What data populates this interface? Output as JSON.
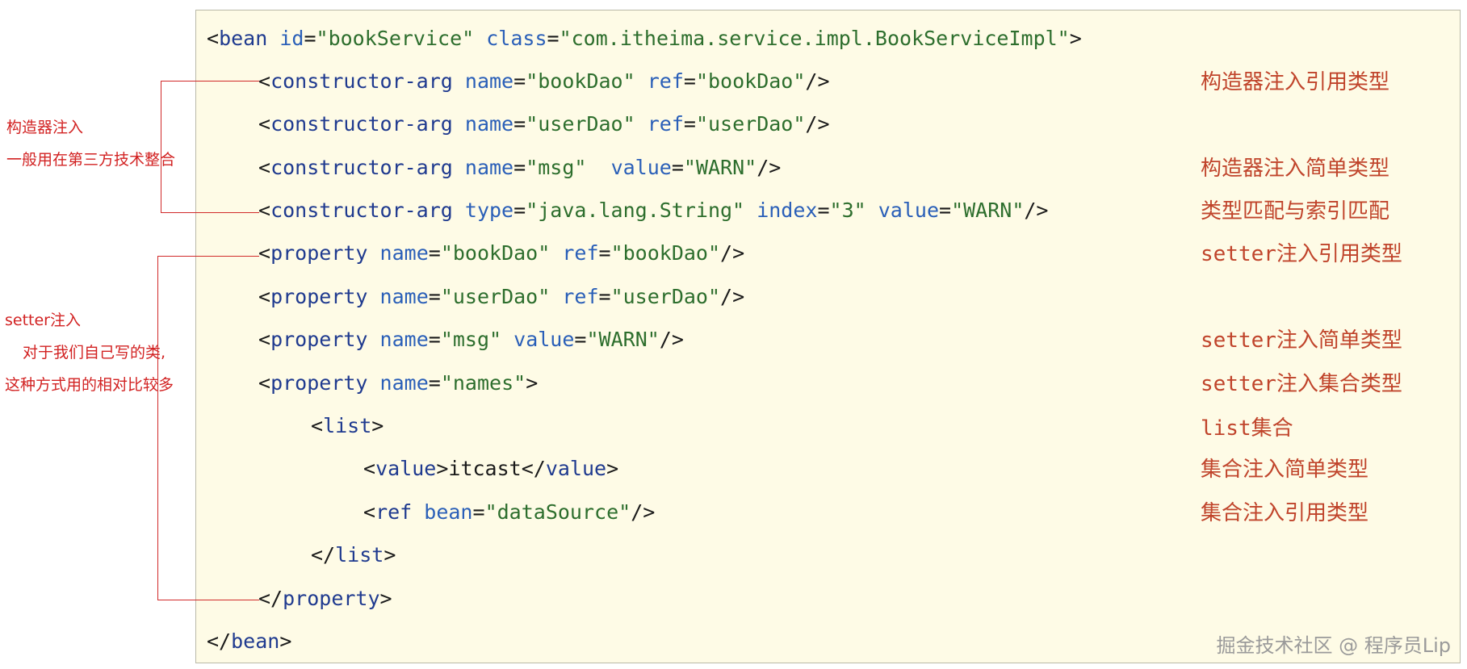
{
  "code": {
    "l1": {
      "o": "<",
      "tag": "bean",
      "a1": "id",
      "eq1": "=",
      "v1": "\"bookService\"",
      "a2": "class",
      "eq2": "=",
      "v2": "\"com.itheima.service.impl.BookServiceImpl\"",
      "c": ">"
    },
    "l2": {
      "o": "<",
      "tag": "constructor-arg",
      "a1": "name",
      "eq1": "=",
      "v1": "\"bookDao\"",
      "a2": "ref",
      "eq2": "=",
      "v2": "\"bookDao\"",
      "c": "/>"
    },
    "l3": {
      "o": "<",
      "tag": "constructor-arg",
      "a1": "name",
      "eq1": "=",
      "v1": "\"userDao\"",
      "a2": "ref",
      "eq2": "=",
      "v2": "\"userDao\"",
      "c": "/>"
    },
    "l4": {
      "o": "<",
      "tag": "constructor-arg",
      "a1": "name",
      "eq1": "=",
      "v1": "\"msg\"",
      "a2": "value",
      "eq2": "=",
      "v2": "\"WARN\"",
      "c": "/>"
    },
    "l5": {
      "o": "<",
      "tag": "constructor-arg",
      "a1": "type",
      "eq1": "=",
      "v1": "\"java.lang.String\"",
      "a2": "index",
      "eq2": "=",
      "v2": "\"3\"",
      "a3": "value",
      "eq3": "=",
      "v3": "\"WARN\"",
      "c": "/>"
    },
    "l6": {
      "o": "<",
      "tag": "property",
      "a1": "name",
      "eq1": "=",
      "v1": "\"bookDao\"",
      "a2": "ref",
      "eq2": "=",
      "v2": "\"bookDao\"",
      "c": "/>"
    },
    "l7": {
      "o": "<",
      "tag": "property",
      "a1": "name",
      "eq1": "=",
      "v1": "\"userDao\"",
      "a2": "ref",
      "eq2": "=",
      "v2": "\"userDao\"",
      "c": "/>"
    },
    "l8": {
      "o": "<",
      "tag": "property",
      "a1": "name",
      "eq1": "=",
      "v1": "\"msg\"",
      "a2": "value",
      "eq2": "=",
      "v2": "\"WARN\"",
      "c": "/>"
    },
    "l9": {
      "o": "<",
      "tag": "property",
      "a1": "name",
      "eq1": "=",
      "v1": "\"names\"",
      "c": ">"
    },
    "l10": {
      "o": "<",
      "tag": "list",
      "c": ">"
    },
    "l11": {
      "o": "<",
      "tag": "value",
      "c": ">",
      "text": "itcast",
      "o2": "</",
      "tag2": "value",
      "c2": ">"
    },
    "l12": {
      "o": "<",
      "tag": "ref",
      "a1": "bean",
      "eq1": "=",
      "v1": "\"dataSource\"",
      "c": "/>"
    },
    "l13": {
      "o": "</",
      "tag": "list",
      "c": ">"
    },
    "l14": {
      "o": "</",
      "tag": "property",
      "c": ">"
    },
    "l15": {
      "o": "</",
      "tag": "bean",
      "c": ">"
    }
  },
  "notes": {
    "n1": "构造器注入引用类型",
    "n2": "构造器注入简单类型",
    "n3": "类型匹配与索引匹配",
    "n4_en": "setter",
    "n4_zh": "注入引用类型",
    "n5_en": "setter",
    "n5_zh": "注入简单类型",
    "n6_en": "setter",
    "n6_zh": "注入集合类型",
    "n7_en": "list",
    "n7_zh": "集合",
    "n8": "集合注入简单类型",
    "n9": "集合注入引用类型"
  },
  "side": {
    "constructor_title": "构造器注入",
    "constructor_desc": "一般用在第三方技术整合",
    "setter_title": "setter注入",
    "setter_desc1": "对于我们自己写的类,",
    "setter_desc2": "这种方式用的相对比较多"
  },
  "watermark": "掘金技术社区 @ 程序员Lip"
}
